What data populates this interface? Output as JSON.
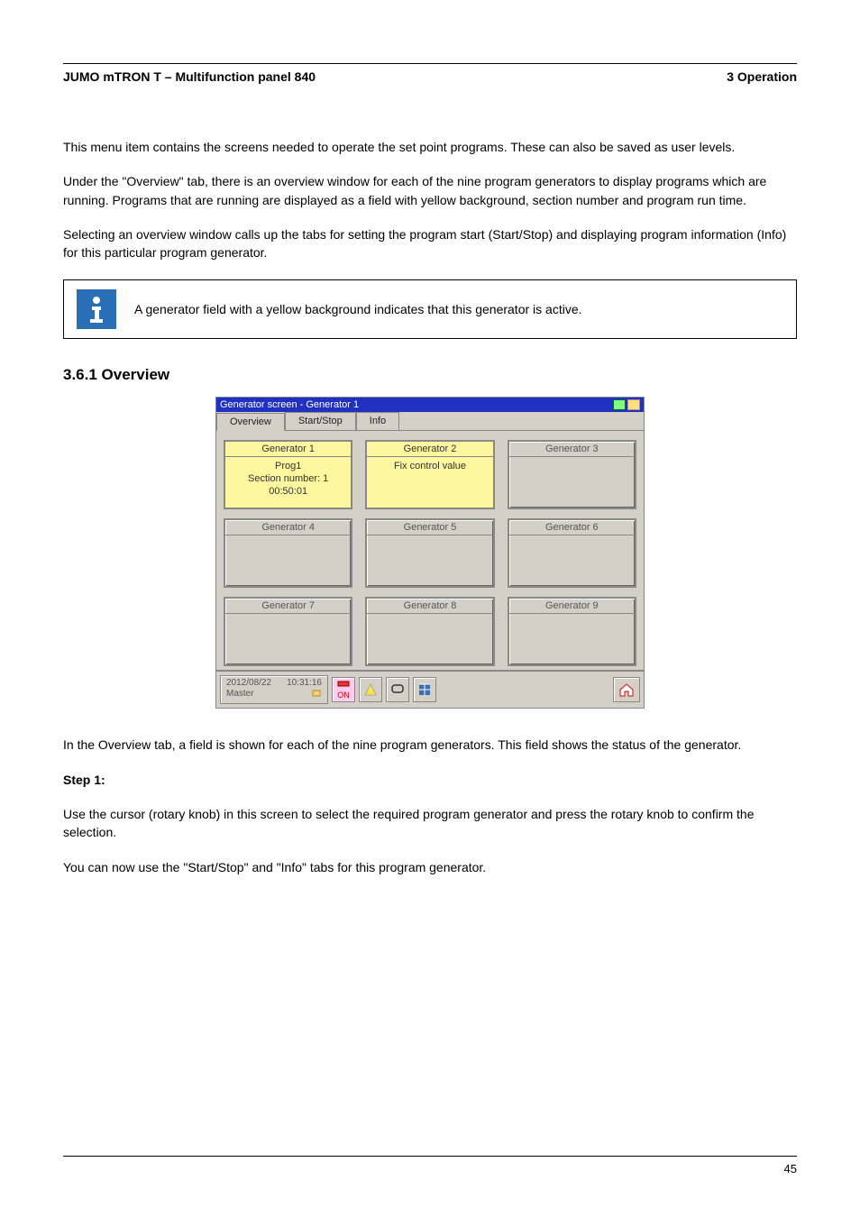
{
  "header": {
    "left": "3 Operation",
    "right": "JUMO mTRON T – Multifunction panel 840"
  },
  "p1": "Under the \"Overview\" tab, there is an overview window for each of the nine program generators to display programs which are running. Programs that are running are displayed as a field with yellow background, section number and program run time.",
  "p2": "Selecting an overview window calls up the tabs for setting the program start (Start/Stop) and displaying program information (Info) for this particular program generator.",
  "p3": "This menu item contains the screens needed to operate the set point programs. These can also be saved as user levels.",
  "info_note": "A generator field with a yellow background indicates that this generator is active.",
  "section_heading": "3.6.1 Overview",
  "screenshot": {
    "title": "Generator screen - Generator 1",
    "tabs": [
      "Overview",
      "Start/Stop",
      "Info"
    ],
    "active_tab": 0,
    "cards": [
      {
        "title": "Generator 1",
        "body_lines": [
          "Prog1",
          "Section number: 1",
          "00:50:01"
        ],
        "warn": true
      },
      {
        "title": "Generator 2",
        "body_lines": [
          "Fix control value"
        ],
        "warn": true
      },
      {
        "title": "Generator 3",
        "body_lines": [],
        "warn": false
      },
      {
        "title": "Generator 4",
        "body_lines": [],
        "warn": false
      },
      {
        "title": "Generator 5",
        "body_lines": [],
        "warn": false
      },
      {
        "title": "Generator 6",
        "body_lines": [],
        "warn": false
      },
      {
        "title": "Generator 7",
        "body_lines": [],
        "warn": false
      },
      {
        "title": "Generator 8",
        "body_lines": [],
        "warn": false
      },
      {
        "title": "Generator 9",
        "body_lines": [],
        "warn": false
      }
    ],
    "status": {
      "date": "2012/08/22",
      "time": "10:31:16",
      "user": "Master",
      "rec_label": "ON"
    }
  },
  "after1": "In the Overview tab, a field is shown for each of the nine program generators. This field shows the status of the generator.",
  "step": "Step 1:",
  "after2": "Use the cursor (rotary knob) in this screen to select the required program generator and press the rotary knob to confirm the selection.",
  "after3": "You can now use the \"Start/Stop\" and \"Info\" tabs for this program generator.",
  "footer": {
    "left": "45",
    "right": ""
  }
}
